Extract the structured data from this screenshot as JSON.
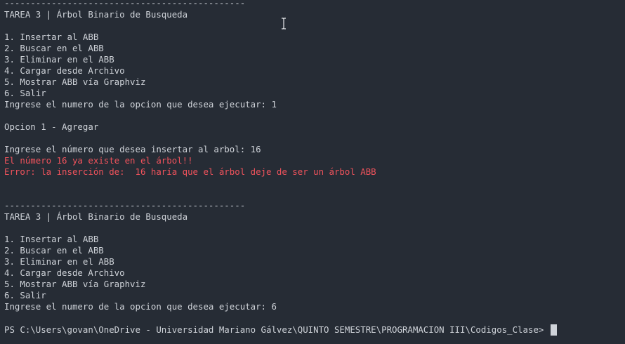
{
  "colors": {
    "background": "#262c35",
    "text": "#cfd3d9",
    "error": "#f1535c"
  },
  "session1": {
    "separator": "----------------------------------------------",
    "title": "TAREA 3 | Árbol Binario de Busqueda",
    "menu": [
      "1. Insertar al ABB",
      "2. Buscar en el ABB",
      "3. Eliminar en el ABB",
      "4. Cargar desde Archivo",
      "5. Mostrar ABB vía Graphviz",
      "6. Salir"
    ],
    "option_prompt": "Ingrese el numero de la opcion que desea ejecutar: 1",
    "option_header": "Opcion 1 - Agregar",
    "insert_prompt": "Ingrese el número que desea insertar al arbol: 16",
    "error1": "El número 16 ya existe en el árbol!!",
    "error2": "Error: la inserción de:  16 haría que el árbol deje de ser un árbol ABB"
  },
  "session2": {
    "separator": "----------------------------------------------",
    "title": "TAREA 3 | Árbol Binario de Busqueda",
    "menu": [
      "1. Insertar al ABB",
      "2. Buscar en el ABB",
      "3. Eliminar en el ABB",
      "4. Cargar desde Archivo",
      "5. Mostrar ABB vía Graphviz",
      "6. Salir"
    ],
    "option_prompt": "Ingrese el numero de la opcion que desea ejecutar: 6"
  },
  "shell_prompt": "PS C:\\Users\\govan\\OneDrive - Universidad Mariano Gálvez\\QUINTO SEMESTRE\\PROGRAMACION III\\Codigos_Clase> ",
  "mouse_cursor_icon": "text-ibeam-cursor-icon"
}
